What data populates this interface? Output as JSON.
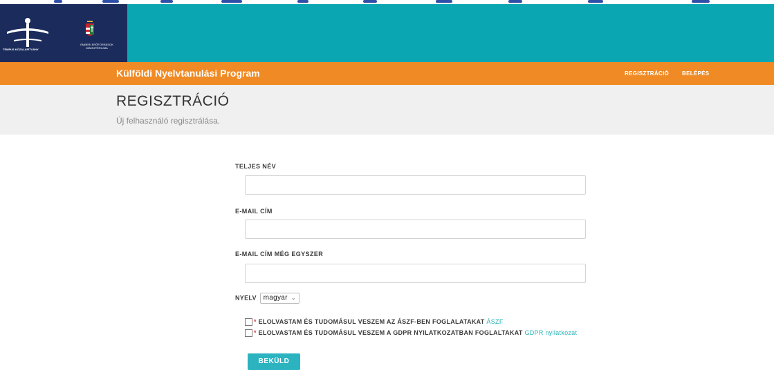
{
  "header": {
    "logo_text_left": "TEMPUS KÖZALAPÍTVÁNY",
    "logo_text_right": "EMBERI ERŐFORRÁSOK MINISZTÉRIUMA"
  },
  "navbar": {
    "brand": "Külföldi Nyelvtanulási Program",
    "links": {
      "register": "REGISZTRÁCIÓ",
      "login": "BELÉPÉS"
    }
  },
  "hero": {
    "title": "REGISZTRÁCIÓ",
    "subtitle": "Új felhasználó regisztrálása."
  },
  "form": {
    "full_name_label": "TELJES NÉV",
    "full_name_value": "",
    "email_label": "E-MAIL CÍM",
    "email_value": "",
    "email_confirm_label": "E-MAIL CÍM MÉG EGYSZER",
    "email_confirm_value": "",
    "language_label": "NYELV",
    "language_selected": "magyar",
    "terms_required_mark": "*",
    "terms_text": "ELOLVASTAM ÉS TUDOMÁSUL VESZEM AZ ÁSZF-BEN FOGLALATAKAT",
    "terms_link": "ÁSZF",
    "gdpr_required_mark": "*",
    "gdpr_text": "ELOLVASTAM ÉS TUDOMÁSUL VESZEM A GDPR NYILATKOZATBAN FOGLALTAKAT",
    "gdpr_link": "GDPR nyilatkozat",
    "submit_label": "BEKÜLD"
  },
  "colors": {
    "header_teal": "#0aa7b3",
    "nav_orange": "#f08a24",
    "logo_navy": "#1b2c5c",
    "button_teal": "#2cb3c0",
    "link_teal": "#20b2b4",
    "required_red": "#e23b3b"
  }
}
